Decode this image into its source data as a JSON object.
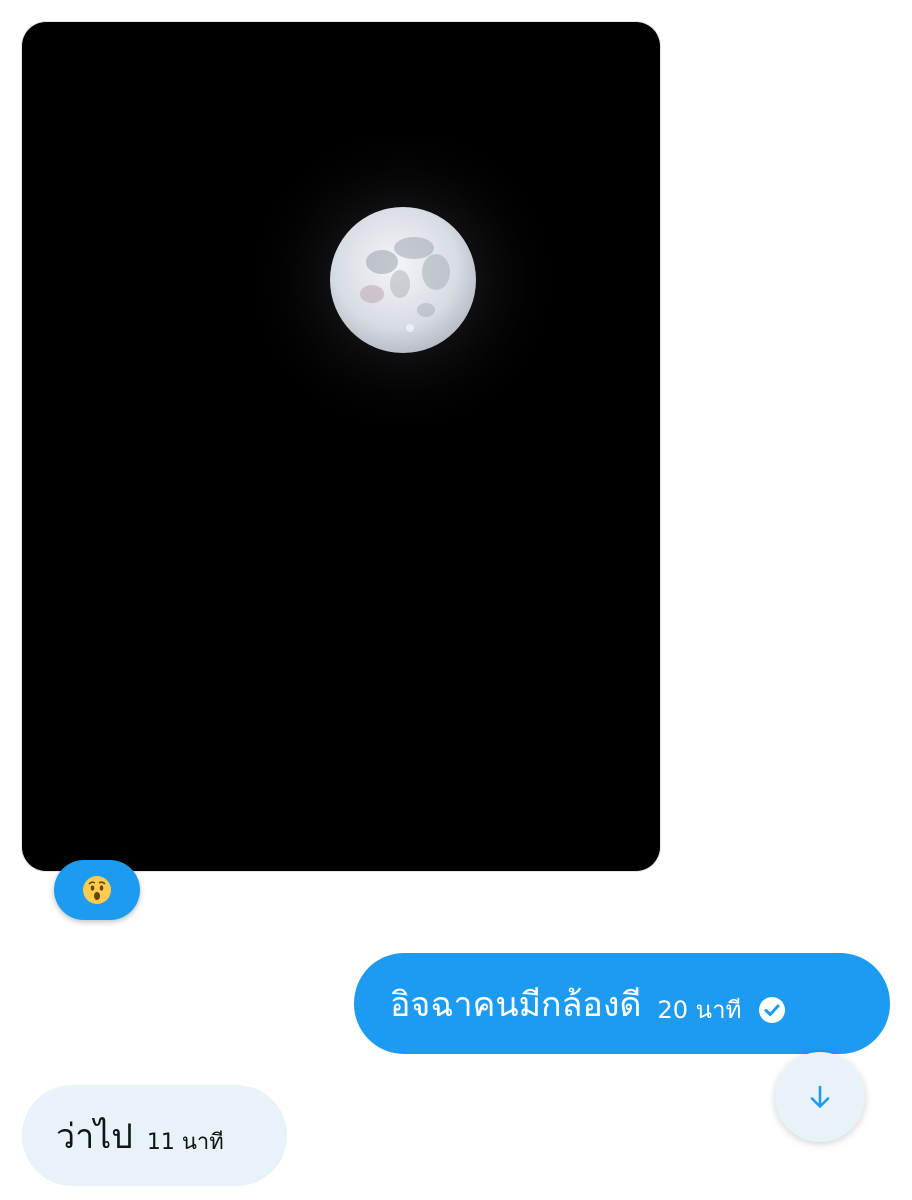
{
  "messages": {
    "photo": {
      "description_icon": "moon-photo"
    },
    "reaction": {
      "emoji": "hushed-face-icon"
    },
    "sent": {
      "text": "อิจฉาคนมีกล้องดี",
      "time": "20 นาที",
      "status_icon": "check-circle-icon"
    },
    "received": {
      "text": "ว่าไป",
      "time": "11 นาที"
    }
  },
  "controls": {
    "scroll_down_icon": "arrow-down-icon"
  },
  "colors": {
    "accent": "#1d9bf0",
    "received_bubble": "#e8f3f9",
    "background": "#ffffff",
    "photo_background": "#000000"
  }
}
